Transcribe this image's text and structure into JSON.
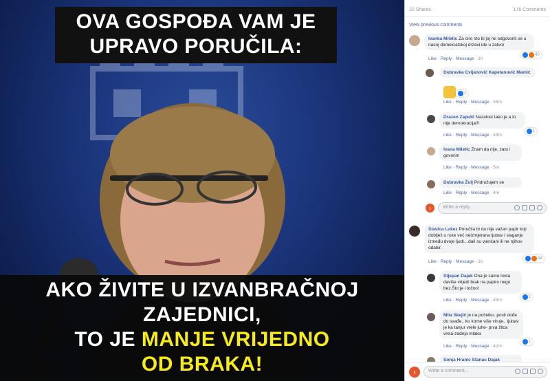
{
  "meme": {
    "top_caption": [
      "OVA GOSPOĐA VAM JE",
      "UPRAVO PORUČILA:"
    ],
    "bottom_caption": {
      "line1": "AKO ŽIVITE U IZVANBRAČNOJ",
      "line2": "ZAJEDNICI,",
      "line3_white": "TO JE ",
      "line3_yellow": "MANJE VRIJEDNO",
      "line4_yellow": "OD BRAKA!"
    }
  },
  "fb": {
    "shares": "22 Shares",
    "comments_count": "176 Comments",
    "view_previous": "View previous comments",
    "actions": {
      "like": "Like",
      "reply": "Reply",
      "message": "Message"
    },
    "comments": [
      {
        "name": "Ivanka Miletic",
        "text": "Za ono sto bi joj mi odgovorili se u nasoj demokratskoj drzavi ide u zatvor",
        "time": "1h",
        "reactions": "40"
      },
      {
        "name": "Dubravka Cvijanović Kapetanović Mamić",
        "text": "",
        "time": "56m",
        "reactions": "1"
      },
      {
        "name": "Drazen Zaputil",
        "text": "Nazalost tako je a to nije demokracija!!!",
        "time": "44m",
        "reactions": "1"
      },
      {
        "name": "Ivana Miletic",
        "text": "Znam da nije, zato i govorim",
        "time": "5m",
        "reactions": ""
      },
      {
        "name": "Dubravka Žulj",
        "text": "Pridružujem se",
        "time": "4m",
        "reactions": ""
      },
      {
        "name": "Slavica Lukez",
        "text": "Poručila bi da nije važan papir koji dobiješ u ruke već neizmjerana ljubav i slaganje između dvoje ljudi…dali su vjenčani ili ne njihov odabir.",
        "time": "1h",
        "reactions": "44"
      },
      {
        "name": "Stjepan Dajak",
        "text": "Ona je samo rekla daviše vrijedi brak na papiru nego bez.Što je i točno!",
        "time": "45m",
        "reactions": "1"
      },
      {
        "name": "Mila Skejić",
        "text": "je na početku..posli dođe do svađe.. ko kome više viruje.. ljubav je ka tanjur vrele juhe- prva žlica vrela-zadnja mlaka",
        "time": "42m",
        "reactions": "1"
      },
      {
        "name": "Sonja Hranic Stanac Dajak",
        "text": "",
        "time": "",
        "reactions": ""
      }
    ],
    "reply_placeholder": "Write a reply...",
    "comment_placeholder": "Write a comment..."
  }
}
